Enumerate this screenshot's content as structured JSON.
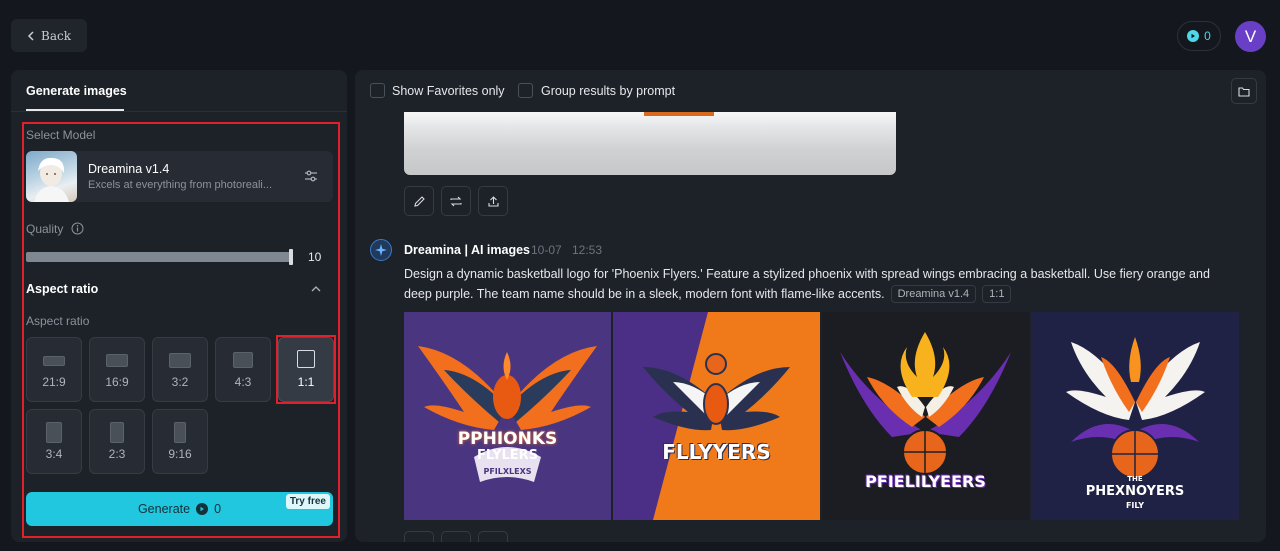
{
  "header": {
    "back_label": "Back",
    "credits": "0",
    "avatar_letter": "V"
  },
  "left_panel": {
    "tab_title": "Generate images",
    "select_model_label": "Select Model",
    "model": {
      "name": "Dreamina v1.4",
      "description": "Excels at everything from photoreali..."
    },
    "quality_label": "Quality",
    "quality_value": "10",
    "quality_fraction": 1.0,
    "aspect_section_title": "Aspect ratio",
    "aspect_label": "Aspect ratio",
    "ratios": [
      {
        "label": "21:9"
      },
      {
        "label": "16:9"
      },
      {
        "label": "3:2"
      },
      {
        "label": "4:3"
      },
      {
        "label": "1:1"
      },
      {
        "label": "3:4"
      },
      {
        "label": "2:3"
      },
      {
        "label": "9:16"
      }
    ],
    "selected_ratio": "1:1",
    "generate_label": "Generate",
    "generate_cost": "0",
    "try_free": "Try free"
  },
  "right_panel": {
    "show_favorites_label": "Show Favorites only",
    "group_results_label": "Group results by prompt",
    "entry": {
      "author": "Dreamina | AI images",
      "date": "10-07",
      "time": "12:53",
      "prompt": "Design a dynamic basketball logo for 'Phoenix Flyers.' Feature a stylized phoenix with spread wings embracing a basketball. Use fiery orange and deep purple. The team name should be in a sleek, modern font with flame-like accents.",
      "model_tag": "Dreamina v1.4",
      "ratio_tag": "1:1",
      "images": [
        {
          "text_main": "PPHIONKS",
          "text_sub": "FLYLERS",
          "text_small": "PFILXLEXS"
        },
        {
          "text_main": "FLLYYERS"
        },
        {
          "text_main": "PFIELILYEERS"
        },
        {
          "text_top": "THE",
          "text_main": "PHEXNOYERS",
          "text_sub": "FILY"
        }
      ]
    }
  },
  "colors": {
    "accent": "#21c7de",
    "highlight": "#e0202a",
    "purple": "#6a3fc7",
    "orange": "#f07a1a"
  }
}
